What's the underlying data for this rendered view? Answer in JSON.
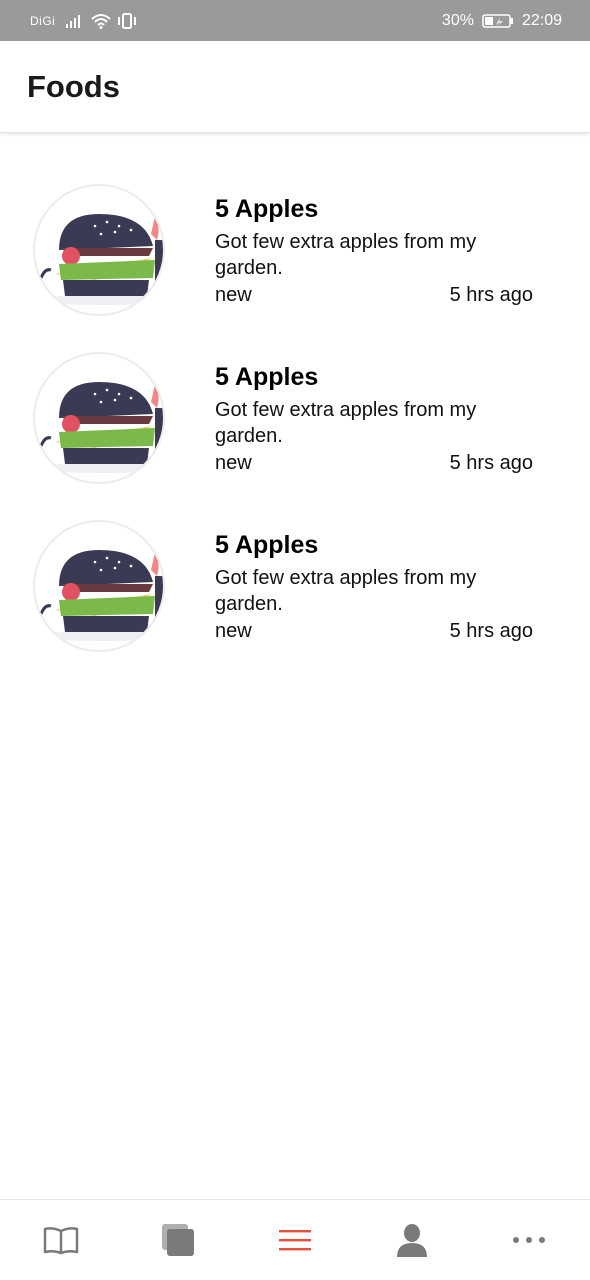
{
  "status_bar": {
    "carrier": "DiGi",
    "battery_percent": "30%",
    "time": "22:09",
    "icons": [
      "signal-icon",
      "wifi-icon",
      "vibrate-icon",
      "battery-icon"
    ]
  },
  "app_bar": {
    "title": "Foods"
  },
  "items": [
    {
      "title": "5 Apples",
      "description": "Got few extra apples from my garden.",
      "status": "new",
      "time": "5 hrs ago",
      "image": "burger-image"
    },
    {
      "title": "5 Apples",
      "description": "Got few extra apples from my garden.",
      "status": "new",
      "time": "5 hrs ago",
      "image": "burger-image"
    },
    {
      "title": "5 Apples",
      "description": "Got few extra apples from my garden.",
      "status": "new",
      "time": "5 hrs ago",
      "image": "burger-image"
    }
  ],
  "bottom_nav": {
    "items": [
      {
        "icon": "book-icon",
        "active": false
      },
      {
        "icon": "layers-icon",
        "active": false
      },
      {
        "icon": "menu-icon",
        "active": true
      },
      {
        "icon": "user-icon",
        "active": false
      },
      {
        "icon": "more-icon",
        "active": false
      }
    ],
    "active_color": "#e8503a",
    "inactive_color": "#7a7a7a"
  }
}
